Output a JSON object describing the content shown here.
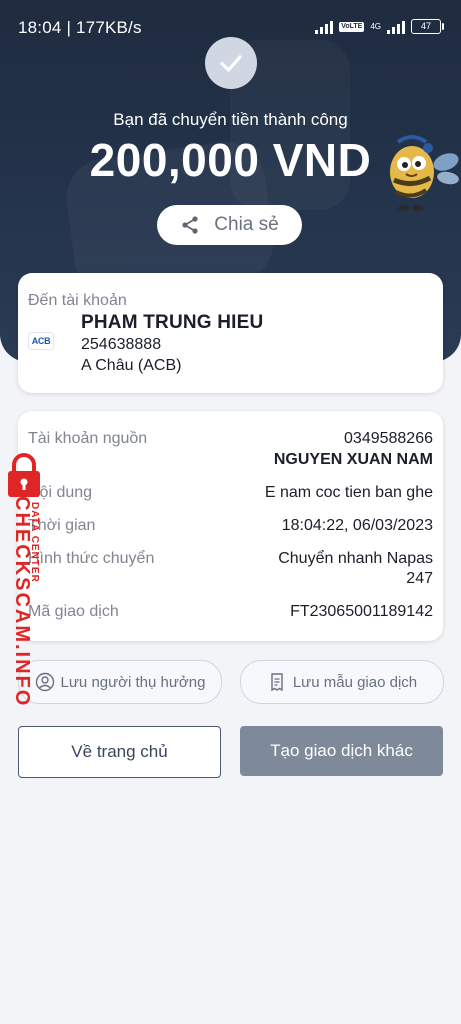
{
  "status_bar": {
    "time_speed": "18:04 | 177KB/s",
    "volte_tag": "VoLTE",
    "network_tag": "4G",
    "battery": "47"
  },
  "hero": {
    "success_text": "Bạn đã chuyển tiền thành công",
    "amount": "200,000 VND",
    "share_label": "Chia sẻ"
  },
  "recipient": {
    "label": "Đến tài khoản",
    "bank_logo": "ACB",
    "name": "PHAM TRUNG HIEU",
    "account": "254638888",
    "bank": "A Châu (ACB)"
  },
  "details": [
    {
      "label": "Tài khoản nguồn",
      "value": "0349588266",
      "value2": "NGUYEN XUAN NAM"
    },
    {
      "label": "Nội dung",
      "value": "E nam coc tien ban ghe"
    },
    {
      "label": "Thời gian",
      "value": "18:04:22, 06/03/2023"
    },
    {
      "label": "Hình thức chuyển",
      "value": "Chuyển nhanh Napas",
      "value2": "247"
    },
    {
      "label": "Mã giao dịch",
      "value": "FT23065001189142"
    }
  ],
  "actions": {
    "save_beneficiary": "Lưu người thụ hưởng",
    "save_template": "Lưu mẫu giao dịch",
    "home": "Về trang chủ",
    "new_transaction": "Tạo giao dịch khác"
  },
  "watermark": {
    "text": "CHECKSCAM.INFO",
    "sub": "DATA CENTER"
  },
  "colors": {
    "hero_bg": "#24344c",
    "primary_btn": "#7e8999",
    "watermark": "#e02525"
  }
}
